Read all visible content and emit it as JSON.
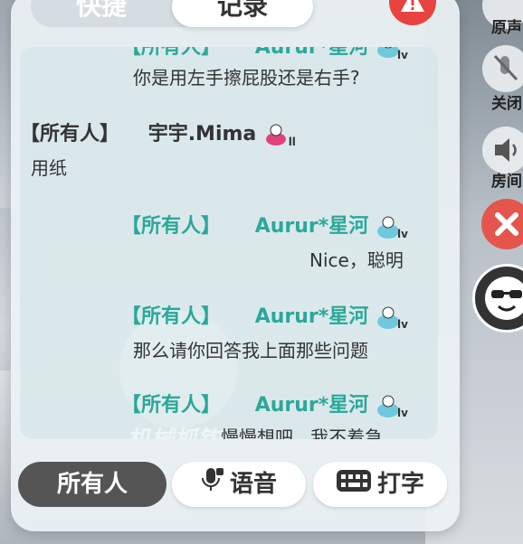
{
  "tabs": {
    "quick": "快捷",
    "record": "记录"
  },
  "messages": [
    {
      "scope": "【所有人】",
      "name": "Aurur*星河",
      "level": "lv",
      "text": "你是用左手擦屁股还是右手?"
    },
    {
      "scope": "【所有人】",
      "name": "宇宇.Mima",
      "level": "ll",
      "text": "用纸"
    },
    {
      "scope": "【所有人】",
      "name": "Aurur*星河",
      "level": "lv",
      "text": "Nice，聪明"
    },
    {
      "scope": "【所有人】",
      "name": "Aurur*星河",
      "level": "lv",
      "text": "那么请你回答我上面那些问题"
    },
    {
      "scope": "【所有人】",
      "name": "Aurur*星河",
      "level": "lv",
      "text": "慢慢想吧.. 我不着急"
    }
  ],
  "watermark": "机械抓钩",
  "bottom": {
    "all": "所有人",
    "voice": "语音",
    "type": "打字"
  },
  "side": {
    "original_sound": "原声",
    "close": "关闭",
    "room_voice": "房间"
  },
  "colors": {
    "accent": "#2aa89a",
    "danger": "#e8433e",
    "dark_button": "#555555"
  },
  "icons": [
    "warning-icon",
    "duck-badge-icon",
    "microphone-icon",
    "keyboard-icon",
    "mute-icon",
    "speaker-icon",
    "close-icon",
    "sunglasses-face-icon"
  ]
}
